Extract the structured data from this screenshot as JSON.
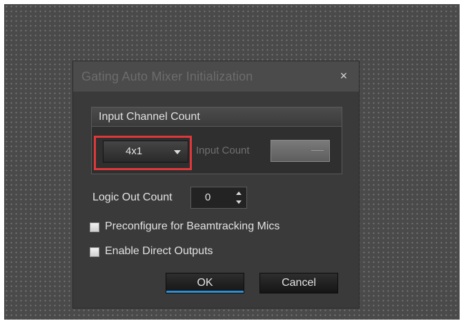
{
  "dialog": {
    "title": "Gating Auto Mixer Initialization",
    "close_glyph": "×"
  },
  "input_channel_group": {
    "header": "Input Channel Count",
    "combo_value": "4x1",
    "input_count_label": "Input Count",
    "input_count_value": ""
  },
  "logic_out": {
    "label": "Logic Out Count",
    "value": "0"
  },
  "options": {
    "preconfigure_label": "Preconfigure for Beamtracking Mics",
    "preconfigure_checked": false,
    "direct_outputs_label": "Enable Direct Outputs",
    "direct_outputs_checked": false
  },
  "buttons": {
    "ok_label": "OK",
    "cancel_label": "Cancel"
  },
  "icons": {
    "close": "close-icon",
    "dropdown": "chevron-down-icon",
    "spin_up": "arrow-up-icon",
    "spin_down": "arrow-down-icon"
  },
  "colors": {
    "highlight": "#e0383a",
    "ok_accent": "#2f8fd6",
    "dialog_bg": "#3a3a3a",
    "titlebar_bg": "#4b4b4b"
  }
}
